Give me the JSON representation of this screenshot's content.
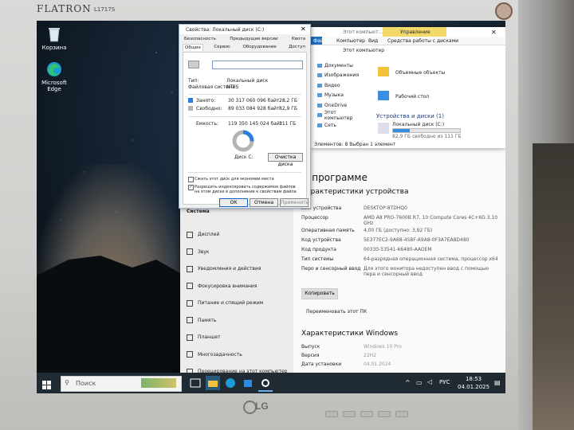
{
  "monitor": {
    "brand": "FLATRON",
    "model": "L1717S",
    "maker": "LG"
  },
  "desktop": {
    "icons": [
      {
        "label": "Корзина",
        "icon": "recycle-bin-icon"
      },
      {
        "label": "Microsoft Edge",
        "icon": "edge-icon"
      }
    ]
  },
  "properties": {
    "title": "Свойства: Локальный диск (C:)",
    "tabs_row1": [
      "Безопасность",
      "Предыдущие версии",
      "Квота"
    ],
    "tabs_row2": [
      "Общие",
      "Сервис",
      "Оборудование",
      "Доступ"
    ],
    "type_label": "Тип:",
    "type_value": "Локальный диск",
    "fs_label": "Файловая система:",
    "fs_value": "NTFS",
    "used_label": "Занято:",
    "used_bytes": "30 317 060 096 байт",
    "used_gb": "28,2 ГБ",
    "free_label": "Свободно:",
    "free_bytes": "89 033 084 928 байт",
    "free_gb": "82,9 ГБ",
    "cap_label": "Емкость:",
    "cap_bytes": "119 350 145 024 байт",
    "cap_gb": "111 ГБ",
    "disk_label": "Диск C:",
    "cleanup": "Очистка диска",
    "compress": "Сжать этот диск для экономии места",
    "index": "Разрешить индексировать содержимое файлов на этом диске в дополнение к свойствам файла",
    "ok": "ОК",
    "cancel": "Отмена",
    "apply": "Применить",
    "used_fraction": 0.254
  },
  "explorer": {
    "tab_file": "Файл",
    "tab_computer": "Компьютер",
    "tab_view": "Вид",
    "ribbon_manage": "Управление",
    "ribbon_tools": "Средства работы с дисками",
    "breadcrumb": "Этот компьютер",
    "nav": [
      "Документы",
      "Изображения",
      "Видео",
      "Музыка",
      "OneDrive",
      "Этот компьютер",
      "Сеть"
    ],
    "folders": [
      "Объемные объекты",
      "Рабочий стол"
    ],
    "section": "Устройства и диски (1)",
    "drive_name": "Локальный диск (C:)",
    "drive_free": "82,9 ГБ свободно из 111 ГБ",
    "status": "Элементов: 8   Выбран 1 элемент",
    "title_short": "Этот компьют..."
  },
  "about": {
    "title": "О программе",
    "section1": "Характеристики устройства",
    "rows": [
      {
        "k": "Имя устройства",
        "v": "DESKTOP-8TDHQ0"
      },
      {
        "k": "Процессор",
        "v": "AMD A8 PRO-7600B R7, 10 Compute Cores 4C+6G      3.10 GHz"
      },
      {
        "k": "Оперативная память",
        "v": "4,00 ГБ (доступно: 3,92 ГБ)"
      },
      {
        "k": "Код устройства",
        "v": "5E377EC2-9A68-458F-A9A8-0F3A7EA8D480"
      },
      {
        "k": "Код продукта",
        "v": "00330-53541-66480-AAOEM"
      },
      {
        "k": "Тип системы",
        "v": "64-разрядная операционная система, процессор x64"
      },
      {
        "k": "Перо и сенсорный ввод",
        "v": "Для этого монитора недоступен ввод с помощью пера и сенсорный ввод"
      }
    ],
    "copy": "Копировать",
    "rename": "Переименовать этот ПК",
    "section2": "Характеристики Windows",
    "rows2": [
      {
        "k": "Выпуск",
        "v": "Windows 10 Pro"
      },
      {
        "k": "Версия",
        "v": "22H2"
      },
      {
        "k": "Дата установки",
        "v": "04.01.2024"
      }
    ]
  },
  "settings_nav": {
    "header": "Система",
    "items": [
      "Дисплей",
      "Звук",
      "Уведомления и действия",
      "Фокусировка внимания",
      "Питание и спящий режим",
      "Память",
      "Планшет",
      "Многозадачность",
      "Проецирование на этот компьютер"
    ]
  },
  "taskbar": {
    "search": "Поиск",
    "lang": "РУС",
    "time": "18:53",
    "date": "04.01.2025"
  }
}
